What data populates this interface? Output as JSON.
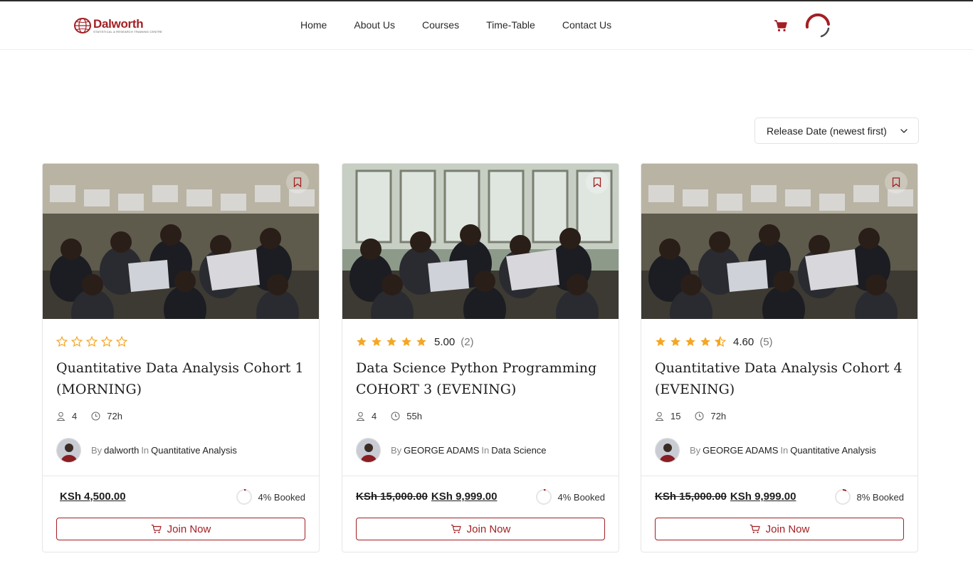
{
  "brand": {
    "name": "Dalworth",
    "tagline": "STATISTICAL & RESEARCH TRAINING CENTRE",
    "color": "#a31f24"
  },
  "nav": {
    "items": [
      {
        "label": "Home"
      },
      {
        "label": "About Us"
      },
      {
        "label": "Courses"
      },
      {
        "label": "Time-Table"
      },
      {
        "label": "Contact Us"
      }
    ]
  },
  "header_icons": [
    "cart-icon",
    "loading-spinner-icon"
  ],
  "sort": {
    "selected": "Release Date (newest first)"
  },
  "courses": [
    {
      "rating": "",
      "rating_count": "",
      "stars": 0,
      "title": "Quantitative Data Analysis Cohort 1 (MORNING)",
      "students": "4",
      "duration": "72h",
      "by": "By",
      "author": "dalworth",
      "in": "In",
      "category": "Quantitative Analysis",
      "price_old": "",
      "price_now": "KSh 4,500.00",
      "booked_pct": 4,
      "booked_label": "4% Booked",
      "cta": "Join Now"
    },
    {
      "rating": "5.00",
      "rating_count": "(2)",
      "stars": 5,
      "title": "Data Science Python Programming COHORT 3 (EVENING)",
      "students": "4",
      "duration": "55h",
      "by": "By",
      "author": "GEORGE ADAMS",
      "in": "In",
      "category": "Data Science",
      "price_old": "KSh 15,000.00",
      "price_now": "KSh 9,999.00",
      "booked_pct": 4,
      "booked_label": "4% Booked",
      "cta": "Join Now"
    },
    {
      "rating": "4.60",
      "rating_count": "(5)",
      "stars": 4.5,
      "title": "Quantitative Data Analysis Cohort 4 (EVENING)",
      "students": "15",
      "duration": "72h",
      "by": "By",
      "author": "GEORGE ADAMS",
      "in": "In",
      "category": "Quantitative Analysis",
      "price_old": "KSh 15,000.00",
      "price_now": "KSh 9,999.00",
      "booked_pct": 8,
      "booked_label": "8% Booked",
      "cta": "Join Now"
    }
  ],
  "colors": {
    "accent": "#a31f24",
    "star": "#f5a623"
  }
}
